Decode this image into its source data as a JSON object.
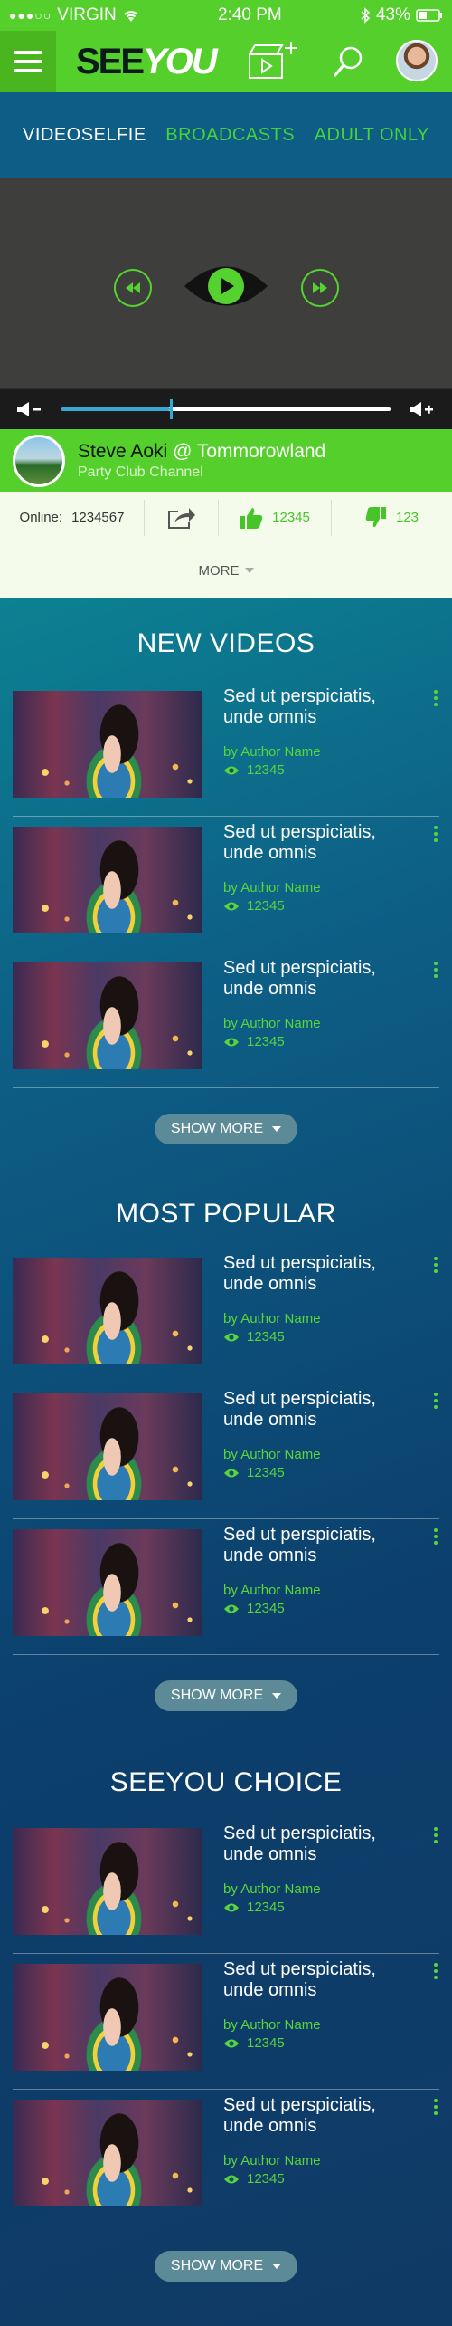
{
  "status_bar": {
    "carrier": "VIRGIN",
    "time": "2:40 PM",
    "battery": "43%",
    "battery_level": 0.43
  },
  "header": {
    "logo_part1": "SEE",
    "logo_part2": "YOU"
  },
  "tabs": [
    {
      "label": "VIDEOSELFIE",
      "active": true
    },
    {
      "label": "BROADCASTS",
      "active": false
    },
    {
      "label": "ADULT ONLY",
      "active": false
    }
  ],
  "player": {
    "volume_level": 0.33
  },
  "channel": {
    "name": "Steve Aoki",
    "location": "@ Tommorowland",
    "subtitle": "Party Club Channel"
  },
  "stats": {
    "online_label": "Online:",
    "online_count": "1234567",
    "likes": "12345",
    "dislikes": "123",
    "more_label": "MORE"
  },
  "sections": [
    {
      "title": "NEW VIDEOS",
      "show_more": "SHOW MORE",
      "items": [
        {
          "title": "Sed ut perspiciatis, unde omnis",
          "by": "by",
          "author": "Author Name",
          "views": "12345"
        },
        {
          "title": "Sed ut perspiciatis, unde omnis",
          "by": "by",
          "author": "Author Name",
          "views": "12345"
        },
        {
          "title": "Sed ut perspiciatis, unde omnis",
          "by": "by",
          "author": "Author Name",
          "views": "12345"
        }
      ]
    },
    {
      "title": "MOST POPULAR",
      "show_more": "SHOW MORE",
      "items": [
        {
          "title": "Sed ut perspiciatis, unde omnis",
          "by": "by",
          "author": "Author Name",
          "views": "12345"
        },
        {
          "title": "Sed ut perspiciatis, unde omnis",
          "by": "by",
          "author": "Author Name",
          "views": "12345"
        },
        {
          "title": "Sed ut perspiciatis, unde omnis",
          "by": "by",
          "author": "Author Name",
          "views": "12345"
        }
      ]
    },
    {
      "title": "SEEYOU CHOICE",
      "show_more": "SHOW MORE",
      "items": [
        {
          "title": "Sed ut perspiciatis, unde omnis",
          "by": "by",
          "author": "Author Name",
          "views": "12345"
        },
        {
          "title": "Sed ut perspiciatis, unde omnis",
          "by": "by",
          "author": "Author Name",
          "views": "12345"
        },
        {
          "title": "Sed ut perspiciatis, unde omnis",
          "by": "by",
          "author": "Author Name",
          "views": "12345"
        }
      ]
    }
  ],
  "colors": {
    "brand_green": "#54cf2b",
    "accent_blue": "#3aa7d3",
    "text_green": "#5ad43b"
  }
}
